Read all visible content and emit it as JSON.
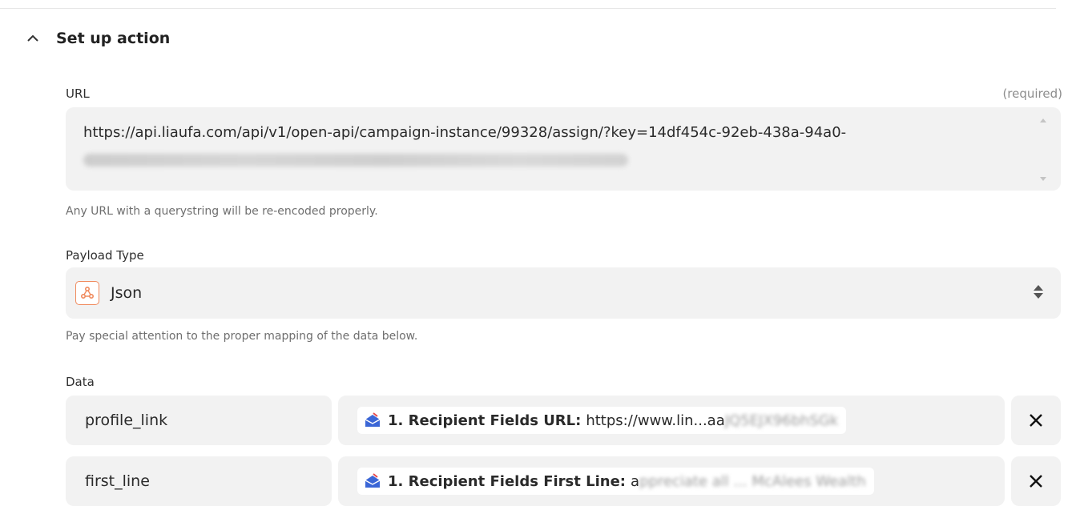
{
  "section": {
    "title": "Set up action"
  },
  "url_field": {
    "label": "URL",
    "required_label": "(required)",
    "value": "https://api.liaufa.com/api/v1/open-api/campaign-instance/99328/assign/?key=14df454c-92eb-438a-94a0-",
    "help": "Any URL with a querystring will be re-encoded properly."
  },
  "payload_type": {
    "label": "Payload Type",
    "value": "Json",
    "icon": "webhook-icon",
    "help": "Pay special attention to the proper mapping of the data below."
  },
  "data": {
    "label": "Data",
    "rows": [
      {
        "key": "profile_link",
        "pill_label": "1. Recipient Fields URL:",
        "pill_value": "https://www.lin...aa",
        "pill_value_blurred": "JQ5EJX96bhSGk"
      },
      {
        "key": "first_line",
        "pill_label": "1. Recipient Fields First Line:",
        "pill_value": "a",
        "pill_value_blurred": "ppreciate all ... McAlees Wealth"
      }
    ]
  },
  "colors": {
    "accent_icon": "#f08a5d",
    "field_bg": "#f2f2f2",
    "envelope_icon": "#3b66d6"
  }
}
